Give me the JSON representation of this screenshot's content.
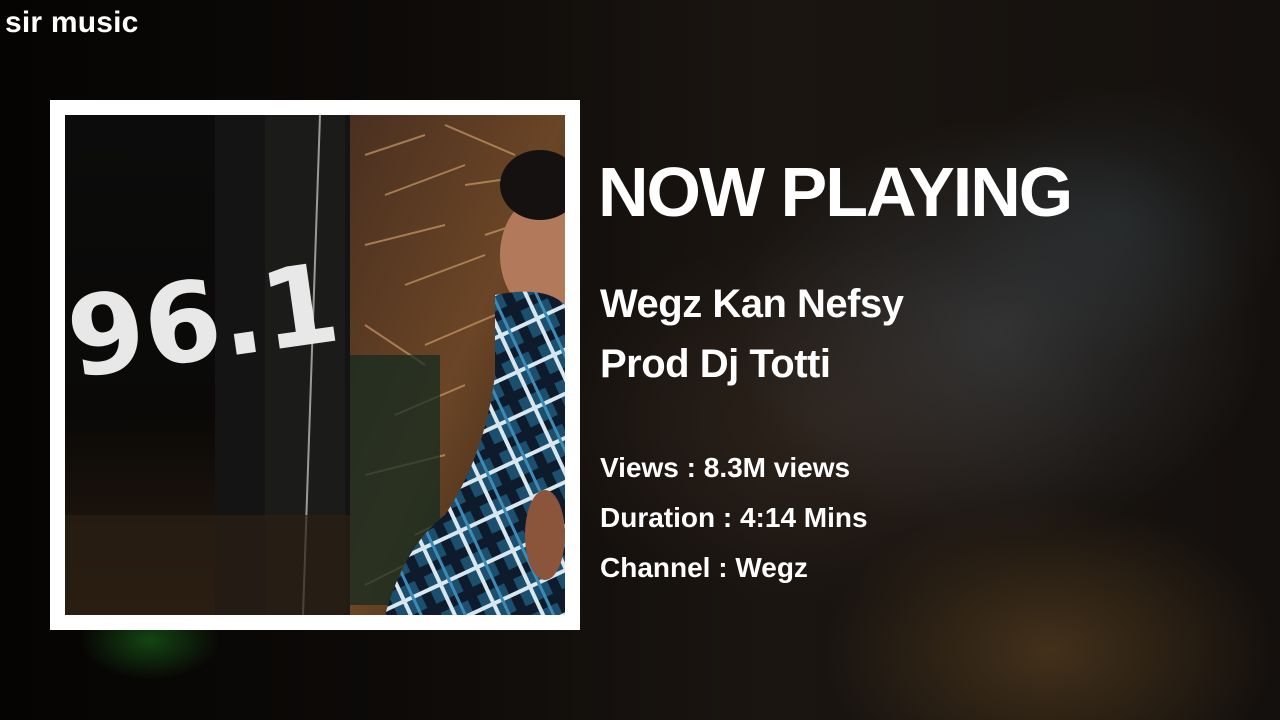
{
  "brand": {
    "name": "sir music"
  },
  "now_playing": {
    "heading": "NOW PLAYING",
    "title_line_1": "Wegz Kan Nefsy",
    "title_line_2": "Prod Dj Totti"
  },
  "details": {
    "views": "Views : 8.3M views",
    "duration": "Duration : 4:14 Mins",
    "channel": "Channel : Wegz"
  },
  "cover": {
    "art_text": "96.1",
    "frame_color": "#ffffff"
  }
}
